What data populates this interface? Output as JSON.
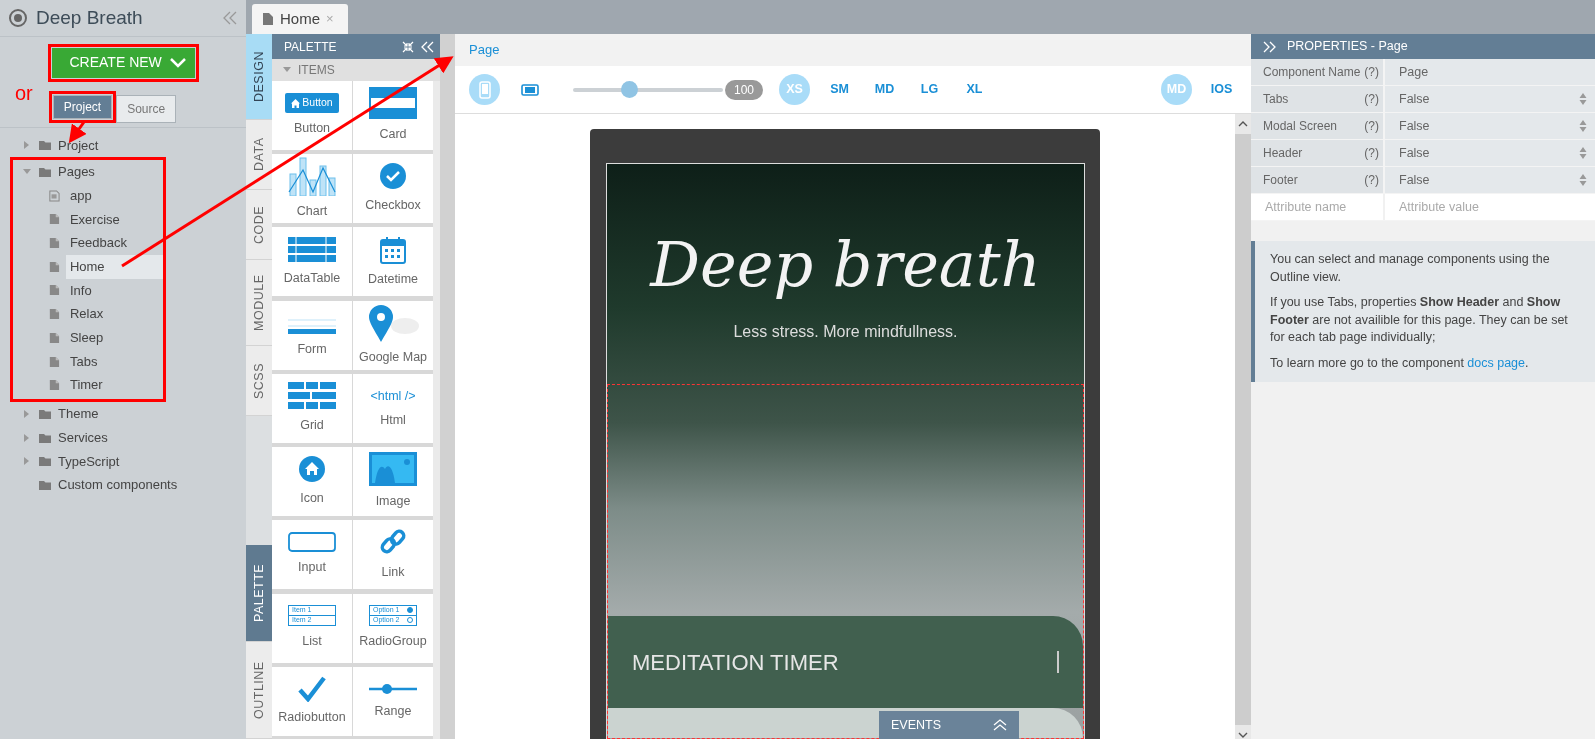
{
  "app": {
    "title": "Deep Breath"
  },
  "create_button": {
    "label": "CREATE NEW"
  },
  "annotation_note": "or",
  "view_toggle": [
    {
      "label": "Project",
      "selected": true
    },
    {
      "label": "Source",
      "selected": false
    }
  ],
  "tree": [
    {
      "label": "Project",
      "kind": "folder",
      "expanded": false
    },
    {
      "label": "Pages",
      "kind": "folder",
      "expanded": true,
      "children": [
        {
          "label": "app",
          "kind": "app-page",
          "selected": false
        },
        {
          "label": "Exercise",
          "kind": "page",
          "selected": false
        },
        {
          "label": "Feedback",
          "kind": "page",
          "selected": false
        },
        {
          "label": "Home",
          "kind": "page",
          "selected": true
        },
        {
          "label": "Info",
          "kind": "page",
          "selected": false
        },
        {
          "label": "Relax",
          "kind": "page",
          "selected": false
        },
        {
          "label": "Sleep",
          "kind": "page",
          "selected": false
        },
        {
          "label": "Tabs",
          "kind": "page",
          "selected": false
        },
        {
          "label": "Timer",
          "kind": "page",
          "selected": false
        }
      ]
    },
    {
      "label": "Theme",
      "kind": "folder",
      "expanded": false
    },
    {
      "label": "Services",
      "kind": "folder",
      "expanded": false
    },
    {
      "label": "TypeScript",
      "kind": "folder",
      "expanded": false
    },
    {
      "label": "Custom components",
      "kind": "plain-folder"
    }
  ],
  "editor_tabs": [
    {
      "label": "Home",
      "selected": true,
      "close": "×"
    }
  ],
  "side_tabs_top": [
    {
      "label": "DESIGN",
      "selected": true
    },
    {
      "label": "DATA",
      "selected": false
    },
    {
      "label": "CODE",
      "selected": false
    },
    {
      "label": "MODULE",
      "selected": false
    },
    {
      "label": "SCSS",
      "selected": false
    }
  ],
  "side_tabs_bottom": [
    {
      "label": "PALETTE",
      "selected": true
    },
    {
      "label": "OUTLINE",
      "selected": false
    }
  ],
  "palette": {
    "title": "PALETTE",
    "section": "ITEMS",
    "expanded": true,
    "items": [
      {
        "label": "Button",
        "kind": "button",
        "icon_text": "Button"
      },
      {
        "label": "Card",
        "kind": "card"
      },
      {
        "label": "Chart",
        "kind": "chart"
      },
      {
        "label": "Checkbox",
        "kind": "checkbox"
      },
      {
        "label": "DataTable",
        "kind": "datatable"
      },
      {
        "label": "Datetime",
        "kind": "datetime"
      },
      {
        "label": "Form",
        "kind": "form"
      },
      {
        "label": "Google Map",
        "kind": "map"
      },
      {
        "label": "Grid",
        "kind": "grid"
      },
      {
        "label": "Html",
        "kind": "html",
        "icon_text": "<html />"
      },
      {
        "label": "Icon",
        "kind": "icon"
      },
      {
        "label": "Image",
        "kind": "image"
      },
      {
        "label": "Input",
        "kind": "input"
      },
      {
        "label": "Link",
        "kind": "link"
      },
      {
        "label": "List",
        "kind": "list",
        "icon_lines": [
          "Item 1",
          "Item 2"
        ]
      },
      {
        "label": "RadioGroup",
        "kind": "radiogroup",
        "icon_lines": [
          "Option 1",
          "Option 2"
        ]
      },
      {
        "label": "Radiobutton",
        "kind": "radiobutton"
      },
      {
        "label": "Range",
        "kind": "range"
      }
    ]
  },
  "breadcrumb": "Page",
  "toolbar": {
    "devices": [
      {
        "kind": "phone",
        "selected": true
      },
      {
        "kind": "tablet",
        "selected": false
      }
    ],
    "zoom": {
      "level": 0.37,
      "reading": "100"
    },
    "breakpoints": [
      {
        "label": "XS",
        "selected": true
      },
      {
        "label": "SM",
        "selected": false
      },
      {
        "label": "MD",
        "selected": false
      },
      {
        "label": "LG",
        "selected": false
      },
      {
        "label": "XL",
        "selected": false
      }
    ],
    "platforms": [
      {
        "label": "MD",
        "selected": true
      },
      {
        "label": "IOS",
        "selected": false
      }
    ]
  },
  "preview": {
    "title": "Deep breath",
    "subtitle": "Less stress. More mindfullness.",
    "card_title": "MEDITATION TIMER"
  },
  "events_panel": {
    "title": "EVENTS"
  },
  "properties": {
    "title": "PROPERTIES - Page",
    "rows": [
      {
        "name": "Component Name",
        "help": "(?)",
        "value": "Page",
        "kind": "text"
      },
      {
        "name": "Tabs",
        "help": "(?)",
        "value": "False",
        "kind": "select"
      },
      {
        "name": "Modal Screen",
        "help": "(?)",
        "value": "False",
        "kind": "select"
      },
      {
        "name": "Header",
        "help": "(?)",
        "value": "False",
        "kind": "select"
      },
      {
        "name": "Footer",
        "help": "(?)",
        "value": "False",
        "kind": "select"
      }
    ],
    "attribute_name_placeholder": "Attribute name",
    "attribute_value_placeholder": "Attribute value",
    "info": [
      "You can select and manage components using the Outline view.",
      "If you use Tabs, properties **Show Header** and **Show Footer** are not availible for this page. They can be set for each tab page individually;"
    ],
    "info_last": {
      "text": "To learn more go to the component ",
      "link": "docs page",
      "end": "."
    }
  }
}
